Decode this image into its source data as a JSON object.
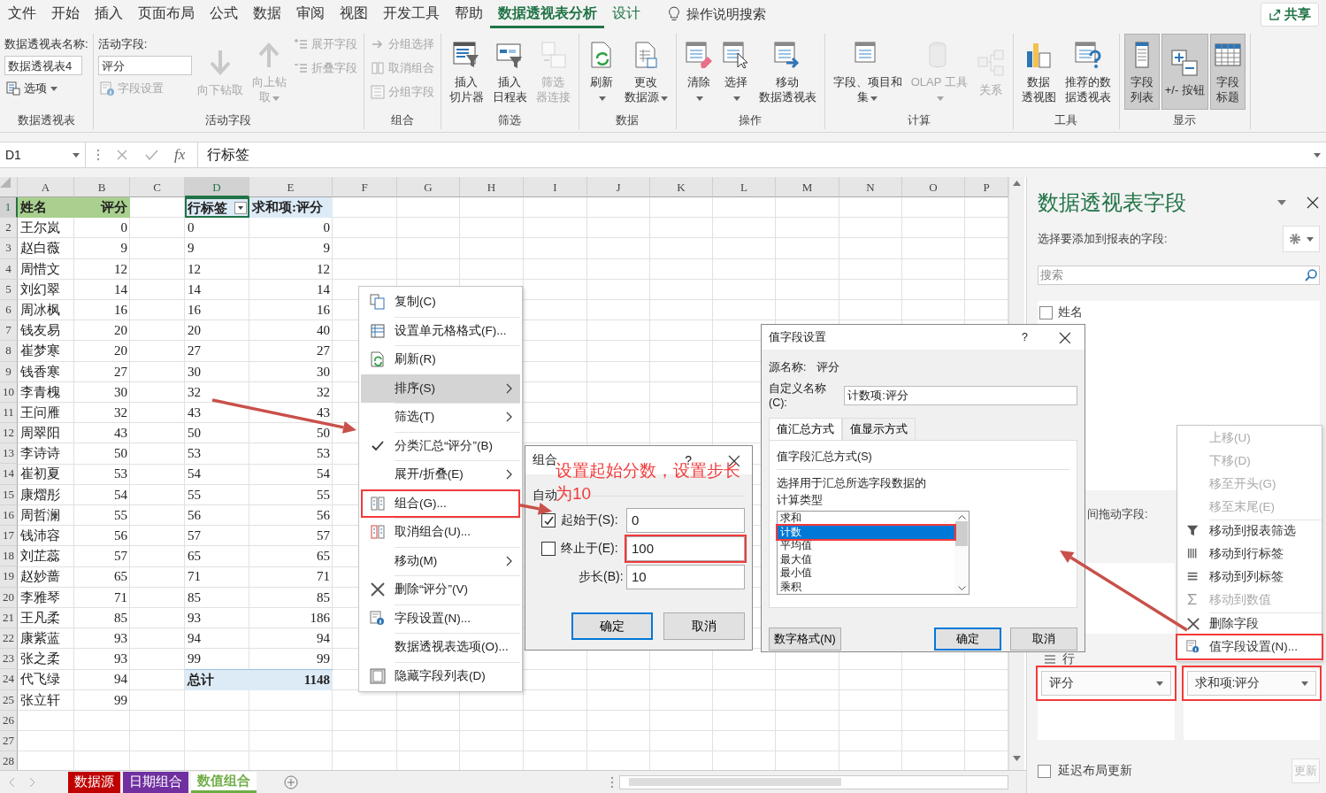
{
  "menu_tabs": [
    {
      "label": "文件",
      "kind": "normal",
      "selected": false
    },
    {
      "label": "开始",
      "kind": "normal",
      "selected": false
    },
    {
      "label": "插入",
      "kind": "normal",
      "selected": false
    },
    {
      "label": "页面布局",
      "kind": "normal",
      "selected": false
    },
    {
      "label": "公式",
      "kind": "normal",
      "selected": false
    },
    {
      "label": "数据",
      "kind": "normal",
      "selected": false
    },
    {
      "label": "审阅",
      "kind": "normal",
      "selected": false
    },
    {
      "label": "视图",
      "kind": "normal",
      "selected": false
    },
    {
      "label": "开发工具",
      "kind": "normal",
      "selected": false
    },
    {
      "label": "帮助",
      "kind": "normal",
      "selected": false
    },
    {
      "label": "数据透视表分析",
      "kind": "contextual",
      "selected": true
    },
    {
      "label": "设计",
      "kind": "contextual",
      "selected": false
    }
  ],
  "tell_me": "操作说明搜索",
  "share": "共享",
  "ribbon": {
    "groups": [
      {
        "label": "数据透视表",
        "columns": [
          [
            {
              "kind": "caption",
              "text": "数据透视表名称:"
            },
            {
              "kind": "field",
              "value": "数据透视表4"
            },
            {
              "kind": "small",
              "lines": [
                "选项"
              ],
              "disabled": false,
              "menu": true
            }
          ]
        ]
      },
      {
        "label": "活动字段",
        "columns": [
          [
            {
              "kind": "caption",
              "text": "活动字段:"
            },
            {
              "kind": "field",
              "value": "评分"
            },
            {
              "kind": "small",
              "lines": [
                "字段设置"
              ],
              "disabled": true,
              "menu": false
            }
          ],
          [
            {
              "kind": "big",
              "lines": [
                "向下钻取"
              ],
              "disabled": true,
              "menu": false
            }
          ],
          [
            {
              "kind": "big",
              "lines": [
                "向上钻",
                "取"
              ],
              "disabled": true,
              "menu": true
            }
          ],
          [
            {
              "kind": "small",
              "lines": [
                "展开字段"
              ],
              "disabled": true,
              "menu": false
            },
            {
              "kind": "small",
              "lines": [
                "折叠字段"
              ],
              "disabled": true,
              "menu": false
            }
          ]
        ]
      },
      {
        "label": "组合",
        "columns": [
          [
            {
              "kind": "small",
              "lines": [
                "分组选择"
              ],
              "disabled": true,
              "menu": false
            },
            {
              "kind": "small",
              "lines": [
                "取消组合"
              ],
              "disabled": true,
              "menu": false
            },
            {
              "kind": "small",
              "lines": [
                "分组字段"
              ],
              "disabled": true,
              "menu": false
            }
          ]
        ]
      },
      {
        "label": "筛选",
        "columns": [
          [
            {
              "kind": "big",
              "lines": [
                "插入",
                "切片器"
              ],
              "disabled": false,
              "menu": false
            }
          ],
          [
            {
              "kind": "big",
              "lines": [
                "插入",
                "日程表"
              ],
              "disabled": false,
              "menu": false
            }
          ],
          [
            {
              "kind": "big",
              "lines": [
                "筛选",
                "器连接"
              ],
              "disabled": true,
              "menu": false
            }
          ]
        ]
      },
      {
        "label": "数据",
        "columns": [
          [
            {
              "kind": "big",
              "lines": [
                "刷新"
              ],
              "disabled": false,
              "menu": true
            }
          ],
          [
            {
              "kind": "big",
              "lines": [
                "更改",
                "数据源"
              ],
              "disabled": false,
              "menu": true
            }
          ]
        ]
      },
      {
        "label": "操作",
        "columns": [
          [
            {
              "kind": "big",
              "lines": [
                "清除"
              ],
              "disabled": false,
              "menu": true
            }
          ],
          [
            {
              "kind": "big",
              "lines": [
                "选择"
              ],
              "disabled": false,
              "menu": true
            }
          ],
          [
            {
              "kind": "big",
              "lines": [
                "移动",
                "数据透视表"
              ],
              "disabled": false,
              "menu": false
            }
          ]
        ]
      },
      {
        "label": "计算",
        "columns": [
          [
            {
              "kind": "big",
              "lines": [
                "字段、项目和",
                "集"
              ],
              "disabled": false,
              "menu": true
            }
          ],
          [
            {
              "kind": "big",
              "lines": [
                "OLAP 工具"
              ],
              "disabled": true,
              "menu": true
            }
          ],
          [
            {
              "kind": "big",
              "lines": [
                "关系"
              ],
              "disabled": true,
              "menu": false
            }
          ]
        ]
      },
      {
        "label": "工具",
        "columns": [
          [
            {
              "kind": "big",
              "lines": [
                "数据",
                "透视图"
              ],
              "disabled": false,
              "menu": false
            }
          ],
          [
            {
              "kind": "big",
              "lines": [
                "推荐的数",
                "据透视表"
              ],
              "disabled": false,
              "menu": false
            }
          ]
        ]
      },
      {
        "label": "显示",
        "columns": [
          [
            {
              "kind": "big",
              "lines": [
                "字段",
                "列表"
              ],
              "disabled": false,
              "menu": false,
              "on": true
            }
          ],
          [
            {
              "kind": "big",
              "lines": [
                "+/- 按钮"
              ],
              "disabled": false,
              "menu": false,
              "on": true
            }
          ],
          [
            {
              "kind": "big",
              "lines": [
                "字段",
                "标题"
              ],
              "disabled": false,
              "menu": false,
              "on": true
            }
          ]
        ]
      }
    ]
  },
  "formula_bar": {
    "name_box": "D1",
    "fx": "fx",
    "formula": "行标签"
  },
  "sheet": {
    "columns": [
      "A",
      "B",
      "C",
      "D",
      "E",
      "F",
      "G",
      "H",
      "I",
      "J",
      "K",
      "L",
      "M",
      "N",
      "O",
      "P"
    ],
    "row_numbers": [
      "1",
      "2",
      "3",
      "4",
      "5",
      "6",
      "7",
      "8",
      "9",
      "10",
      "11",
      "12",
      "13",
      "14",
      "15",
      "16",
      "17",
      "18",
      "19",
      "20",
      "21",
      "22",
      "23",
      "24",
      "25",
      "26",
      "27",
      "28"
    ],
    "source": {
      "header": [
        "姓名",
        "评分"
      ],
      "rows": [
        [
          "王尔岚",
          "0"
        ],
        [
          "赵白薇",
          "9"
        ],
        [
          "周惜文",
          "12"
        ],
        [
          "刘幻翠",
          "14"
        ],
        [
          "周冰枫",
          "16"
        ],
        [
          "钱友易",
          "20"
        ],
        [
          "崔梦寒",
          "20"
        ],
        [
          "钱香寒",
          "27"
        ],
        [
          "李青槐",
          "30"
        ],
        [
          "王问雁",
          "32"
        ],
        [
          "周翠阳",
          "43"
        ],
        [
          "李诗诗",
          "50"
        ],
        [
          "崔初夏",
          "53"
        ],
        [
          "康熠彤",
          "54"
        ],
        [
          "周哲澜",
          "55"
        ],
        [
          "钱沛容",
          "56"
        ],
        [
          "刘芷蕊",
          "57"
        ],
        [
          "赵妙蔷",
          "65"
        ],
        [
          "李雅琴",
          "71"
        ],
        [
          "王凡柔",
          "85"
        ],
        [
          "康紫蓝",
          "93"
        ],
        [
          "张之柔",
          "93"
        ],
        [
          "代飞绿",
          "94"
        ],
        [
          "张立轩",
          "99"
        ]
      ]
    },
    "pivot": {
      "row_label": "行标签",
      "value_label": "求和项:评分",
      "row_label_selected": true,
      "rows": [
        [
          "0",
          "0"
        ],
        [
          "9",
          "9"
        ],
        [
          "12",
          "12"
        ],
        [
          "14",
          "14"
        ],
        [
          "16",
          "16"
        ],
        [
          "20",
          "40"
        ],
        [
          "27",
          "27"
        ],
        [
          "30",
          "30"
        ],
        [
          "32",
          "32"
        ],
        [
          "43",
          "43"
        ],
        [
          "50",
          "50"
        ],
        [
          "53",
          "53"
        ],
        [
          "54",
          "54"
        ],
        [
          "55",
          "55"
        ],
        [
          "56",
          "56"
        ],
        [
          "57",
          "57"
        ],
        [
          "65",
          "65"
        ],
        [
          "71",
          "71"
        ],
        [
          "85",
          "85"
        ],
        [
          "93",
          "186"
        ],
        [
          "94",
          "94"
        ],
        [
          "99",
          "99"
        ]
      ],
      "total": [
        "总计",
        "1148"
      ]
    }
  },
  "sheet_tabs": [
    {
      "label": "数据源",
      "color": "#c00000",
      "selected": false
    },
    {
      "label": "日期组合",
      "color": "#7030a0",
      "selected": false
    },
    {
      "label": "数值组合",
      "color": "#70ad47",
      "selected": true
    }
  ],
  "context_menu": {
    "items": [
      {
        "label": "复制(C)",
        "kind": "copy",
        "submenu": false,
        "checked": false,
        "highlighted": false
      },
      {
        "label": "设置单元格格式(F)...",
        "kind": "format",
        "submenu": false,
        "checked": false,
        "highlighted": false
      },
      {
        "label": "刷新(R)",
        "kind": "refresh",
        "submenu": false,
        "checked": false,
        "highlighted": false
      },
      {
        "label": "排序(S)",
        "kind": "plain",
        "submenu": true,
        "checked": false,
        "highlighted": true
      },
      {
        "label": "筛选(T)",
        "kind": "plain",
        "submenu": true,
        "checked": false,
        "highlighted": false
      },
      {
        "label": "分类汇总“评分”(B)",
        "kind": "plain",
        "submenu": false,
        "checked": true,
        "highlighted": false
      },
      {
        "label": "展开/折叠(E)",
        "kind": "plain",
        "submenu": true,
        "checked": false,
        "highlighted": false
      },
      {
        "label": "组合(G)...",
        "kind": "group",
        "submenu": false,
        "checked": false,
        "highlighted": false
      },
      {
        "label": "取消组合(U)...",
        "kind": "ungroup",
        "submenu": false,
        "checked": false,
        "highlighted": false
      },
      {
        "label": "移动(M)",
        "kind": "plain",
        "submenu": true,
        "checked": false,
        "highlighted": false
      },
      {
        "label": "删除“评分”(V)",
        "kind": "delete",
        "submenu": false,
        "checked": false,
        "highlighted": false
      },
      {
        "label": "字段设置(N)...",
        "kind": "settings",
        "submenu": false,
        "checked": false,
        "highlighted": false
      },
      {
        "label": "数据透视表选项(O)...",
        "kind": "plain",
        "submenu": false,
        "checked": false,
        "highlighted": false
      },
      {
        "label": "隐藏字段列表(D)",
        "kind": "fieldlist",
        "submenu": false,
        "checked": false,
        "highlighted": false
      }
    ]
  },
  "group_dialog": {
    "title": "组合",
    "help": "?",
    "section": "自动",
    "rows": [
      {
        "label": "起始于(S):",
        "kind": "checkbox",
        "checked": true,
        "value": "0"
      },
      {
        "label": "终止于(E):",
        "kind": "checkbox",
        "checked": false,
        "value": "100"
      },
      {
        "label": "步长(B):",
        "kind": "plain",
        "value": "10"
      }
    ],
    "buttons": [
      {
        "label": "确定",
        "default": true
      },
      {
        "label": "取消",
        "default": false
      }
    ]
  },
  "value_field_dialog": {
    "title": "值字段设置",
    "help": "?",
    "source_label": "源名称:",
    "source_value": "评分",
    "custom_name_label": "自定义名称(C):",
    "custom_name": "计数项:评分",
    "tabs": [
      {
        "label": "值汇总方式",
        "selected": true
      },
      {
        "label": "值显示方式",
        "selected": false
      }
    ],
    "section": "值字段汇总方式(S)",
    "description": [
      "选择用于汇总所选字段数据的",
      "计算类型"
    ],
    "options": [
      {
        "label": "求和",
        "selected": false
      },
      {
        "label": "计数",
        "selected": true
      },
      {
        "label": "平均值",
        "selected": false
      },
      {
        "label": "最大值",
        "selected": false
      },
      {
        "label": "最小值",
        "selected": false
      },
      {
        "label": "乘积",
        "selected": false
      }
    ],
    "number_format_button": "数字格式(N)",
    "buttons": [
      {
        "label": "确定",
        "default": true
      },
      {
        "label": "取消",
        "default": false
      }
    ]
  },
  "field_pane": {
    "title": "数据透视表字段",
    "prompt": "选择要添加到报表的字段:",
    "search_placeholder": "搜索",
    "fields": [
      {
        "label": "姓名",
        "checked": false
      }
    ],
    "drag_prompt": "间拖动字段:",
    "rows_area": {
      "label": "行",
      "items": [
        "评分"
      ]
    },
    "values_area": {
      "items": [
        "求和项:评分"
      ]
    },
    "defer": {
      "label": "延迟布局更新",
      "checked": false
    },
    "update_button": {
      "label": "更新",
      "disabled": true
    }
  },
  "pane_menu": {
    "items": [
      {
        "label": "上移(U)",
        "kind": "plain",
        "disabled": true
      },
      {
        "label": "下移(D)",
        "kind": "plain",
        "disabled": true
      },
      {
        "label": "移至开头(G)",
        "kind": "plain",
        "disabled": true
      },
      {
        "label": "移至末尾(E)",
        "kind": "plain",
        "disabled": true
      },
      {
        "label": "移动到报表筛选",
        "kind": "filter",
        "disabled": false
      },
      {
        "label": "移动到行标签",
        "kind": "rows",
        "disabled": false
      },
      {
        "label": "移动到列标签",
        "kind": "columns",
        "disabled": false
      },
      {
        "label": "移动到数值",
        "kind": "values",
        "disabled": true
      },
      {
        "label": "删除字段",
        "kind": "remove",
        "disabled": false
      },
      {
        "label": "值字段设置(N)...",
        "kind": "settings",
        "disabled": false
      }
    ]
  },
  "annotation": {
    "lines": [
      "设置起始分数，设置步长",
      "为10"
    ]
  }
}
